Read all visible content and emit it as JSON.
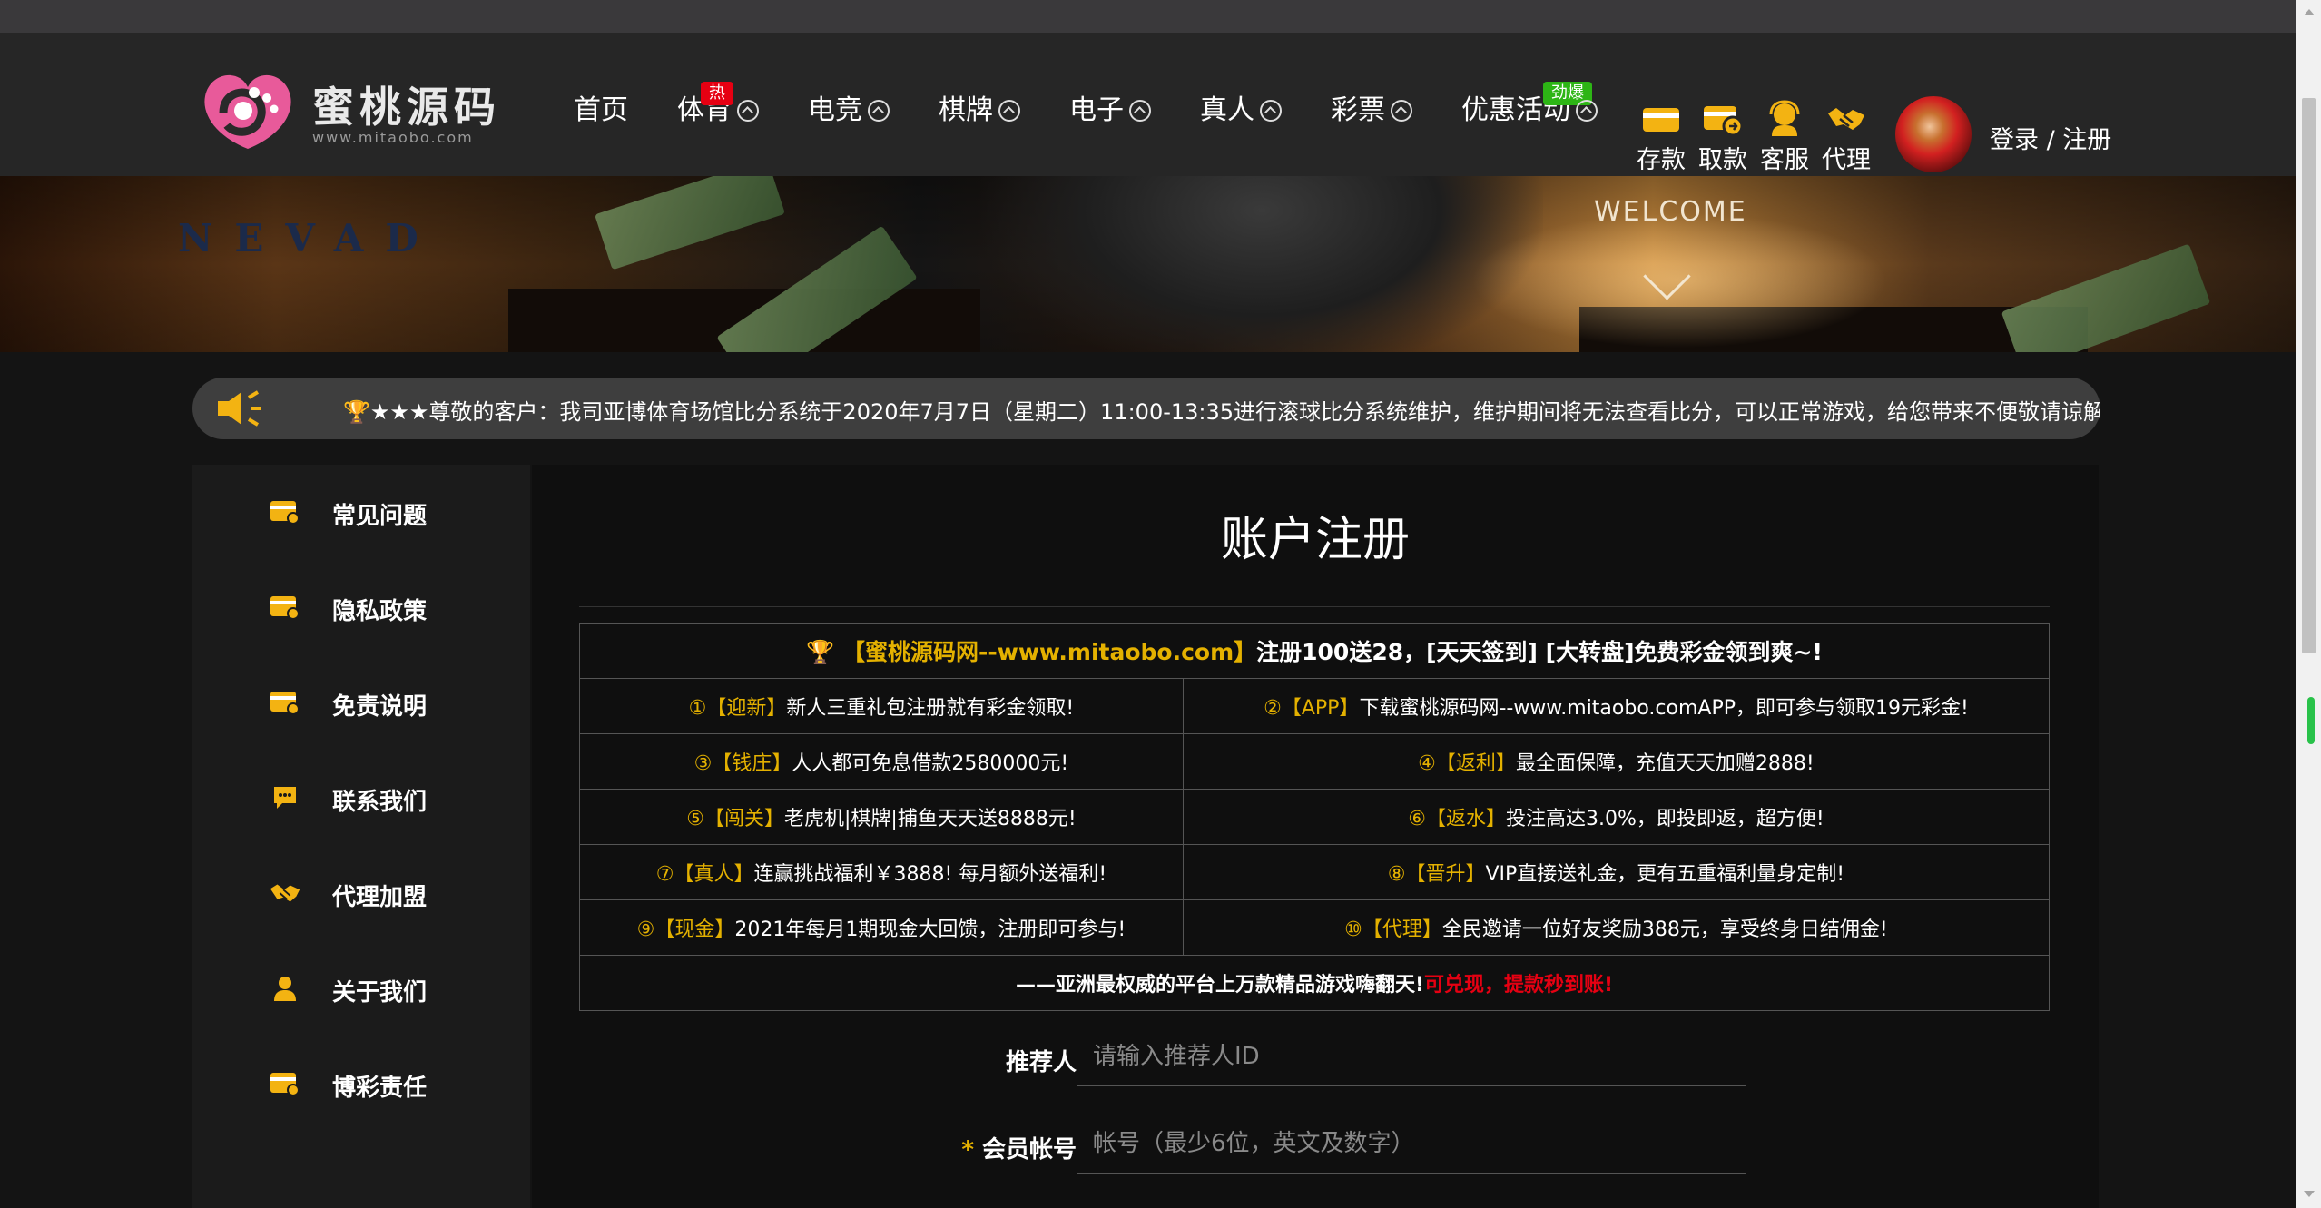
{
  "brand": {
    "name": "蜜桃源码",
    "url_text": "www.mitaobo.com"
  },
  "nav": {
    "items": [
      {
        "label": "首页"
      },
      {
        "label": "体育",
        "badge": "热"
      },
      {
        "label": "电竞"
      },
      {
        "label": "棋牌"
      },
      {
        "label": "电子"
      },
      {
        "label": "真人"
      },
      {
        "label": "彩票"
      },
      {
        "label": "优惠活动",
        "badge": "劲爆"
      }
    ]
  },
  "quick_links": [
    {
      "label": "存款",
      "icon": "wallet-icon"
    },
    {
      "label": "取款",
      "icon": "withdraw-icon"
    },
    {
      "label": "客服",
      "icon": "customer-service-icon"
    },
    {
      "label": "代理",
      "icon": "handshake-icon"
    }
  ],
  "user": {
    "login_label": "登录 / 注册"
  },
  "banner": {
    "nevada": "NEVAD",
    "welcome": "WELCOME"
  },
  "notice": {
    "text": "★★★尊敬的客户：我司亚博体育场馆比分系统于2020年7月7日（星期二）11:00-13:35进行滚球比分系统维护，维护期间将无法查看比分，可以正常游戏，给您带来不便敬请谅解"
  },
  "sidebar": {
    "items": [
      {
        "label": "常见问题",
        "icon": "card-icon"
      },
      {
        "label": "隐私政策",
        "icon": "card-icon"
      },
      {
        "label": "免责说明",
        "icon": "card-icon"
      },
      {
        "label": "联系我们",
        "icon": "chat-icon"
      },
      {
        "label": "代理加盟",
        "icon": "handshake-icon"
      },
      {
        "label": "关于我们",
        "icon": "user-icon"
      },
      {
        "label": "博彩责任",
        "icon": "card-icon"
      }
    ]
  },
  "page": {
    "title": "账户注册"
  },
  "promo": {
    "header_gold": "【蜜桃源码网--www.mitaobo.com】",
    "header_white": "注册100送28，[天天签到] [大转盘]免费彩金领到爽~!",
    "rows": [
      [
        {
          "num": "①",
          "tag": "【迎新】",
          "text": "新人三重礼包注册就有彩金领取!"
        },
        {
          "num": "②",
          "tag": "【APP】",
          "text": "下载蜜桃源码网--www.mitaobo.comAPP，即可参与领取19元彩金!"
        }
      ],
      [
        {
          "num": "③",
          "tag": "【钱庄】",
          "text": "人人都可免息借款2580000元!"
        },
        {
          "num": "④",
          "tag": "【返利】",
          "text": "最全面保障，充值天天加赠2888!"
        }
      ],
      [
        {
          "num": "⑤",
          "tag": "【闯关】",
          "text": "老虎机|棋牌|捕鱼天天送8888元!"
        },
        {
          "num": "⑥",
          "tag": "【返水】",
          "text": "投注高达3.0%，即投即返，超方便!"
        }
      ],
      [
        {
          "num": "⑦",
          "tag": "【真人】",
          "text": "连赢挑战福利￥3888! 每月额外送福利!"
        },
        {
          "num": "⑧",
          "tag": "【晋升】",
          "text": "VIP直接送礼金，更有五重福利量身定制!"
        }
      ],
      [
        {
          "num": "⑨",
          "tag": "【现金】",
          "text": "2021年每月1期现金大回馈，注册即可参与!"
        },
        {
          "num": "⑩",
          "tag": "【代理】",
          "text": "全民邀请一位好友奖励388元，享受终身日结佣金!"
        }
      ]
    ],
    "footer_white": "——亚洲最权威的平台上万款精品游戏嗨翻天!",
    "footer_red": "可兑现，提款秒到账!"
  },
  "form": {
    "referrer": {
      "label": "推荐人",
      "placeholder": "请输入推荐人ID",
      "value": ""
    },
    "account": {
      "required_mark": "*",
      "label": "会员帐号",
      "placeholder": "帐号（最少6位，英文及数字）",
      "value": ""
    }
  },
  "colors": {
    "accent_gold": "#e4b100",
    "hot_red": "#e60012",
    "new_green": "#2db515",
    "header_bg": "#262626"
  }
}
